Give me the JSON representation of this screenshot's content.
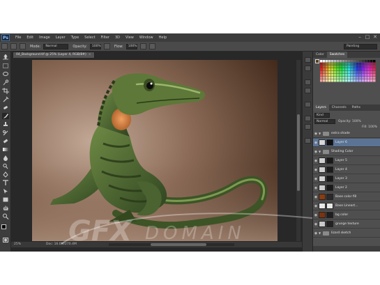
{
  "app": {
    "logo": "Ps",
    "menu": [
      "File",
      "Edit",
      "Image",
      "Layer",
      "Type",
      "Select",
      "Filter",
      "3D",
      "View",
      "Window",
      "Help"
    ]
  },
  "options": {
    "mode_label": "Mode:",
    "mode_value": "Normal",
    "opacity_label": "Opacity:",
    "opacity_value": "100%",
    "flow_label": "Flow:",
    "flow_value": "100%",
    "workspace": "Painting"
  },
  "document": {
    "tab_title": "04_Background.tif @ 25% (Layer 4, RGB/8#)",
    "zoom": "25%",
    "doc_size": "Doc: 16.0M/270.4M"
  },
  "panels": {
    "top_tabs": [
      "Color",
      "Swatches"
    ],
    "mid_tabs": [
      "Layers",
      "Channels",
      "Paths"
    ],
    "kind_label": "Kind",
    "blend_label": "Normal",
    "opacity_label": "Opacity: 100%",
    "fill_label": "Fill: 100%"
  },
  "layers": [
    {
      "name": "extra shade",
      "type": "group"
    },
    {
      "name": "Layer 6",
      "type": "layer",
      "selected": true,
      "thumb": "#d8d8d8",
      "mask": "#111111"
    },
    {
      "name": "Shading Color",
      "type": "group"
    },
    {
      "name": "Layer 5",
      "type": "layer",
      "thumb": "#d0d0d0",
      "mask": "#1a1a1a"
    },
    {
      "name": "Layer 4",
      "type": "layer",
      "thumb": "#cfcfcf",
      "mask": "#1c1c1c"
    },
    {
      "name": "Layer 3",
      "type": "layer",
      "thumb": "#d2d2d2",
      "mask": "#181818"
    },
    {
      "name": "Layer 2",
      "type": "layer",
      "thumb": "#cdcdcd",
      "mask": "#1a1a1a"
    },
    {
      "name": "Base color fill",
      "type": "layer",
      "thumb": "#8a3c12",
      "mask": "#2a2a2a"
    },
    {
      "name": "Base Lineart...",
      "type": "layer",
      "thumb": "#e8e8e8",
      "mask": "#e8e8e8"
    },
    {
      "name": "bg color",
      "type": "layer",
      "thumb": "#7a3410",
      "mask": "#1e1e1e"
    },
    {
      "name": "grunge texture",
      "type": "layer",
      "thumb": "#c9c9c9",
      "mask": "#222222"
    },
    {
      "name": "lizard sketch",
      "type": "group"
    }
  ],
  "watermark": {
    "text_bold": "GFX",
    "text_light": "DOMAIN"
  },
  "colors": {
    "chrome_dark": "#2b2b2b",
    "panel": "#4f4f4f",
    "selection": "#5b7496",
    "canvas_bg": "#5a3b28",
    "lizard_green": "#4f6a33"
  }
}
